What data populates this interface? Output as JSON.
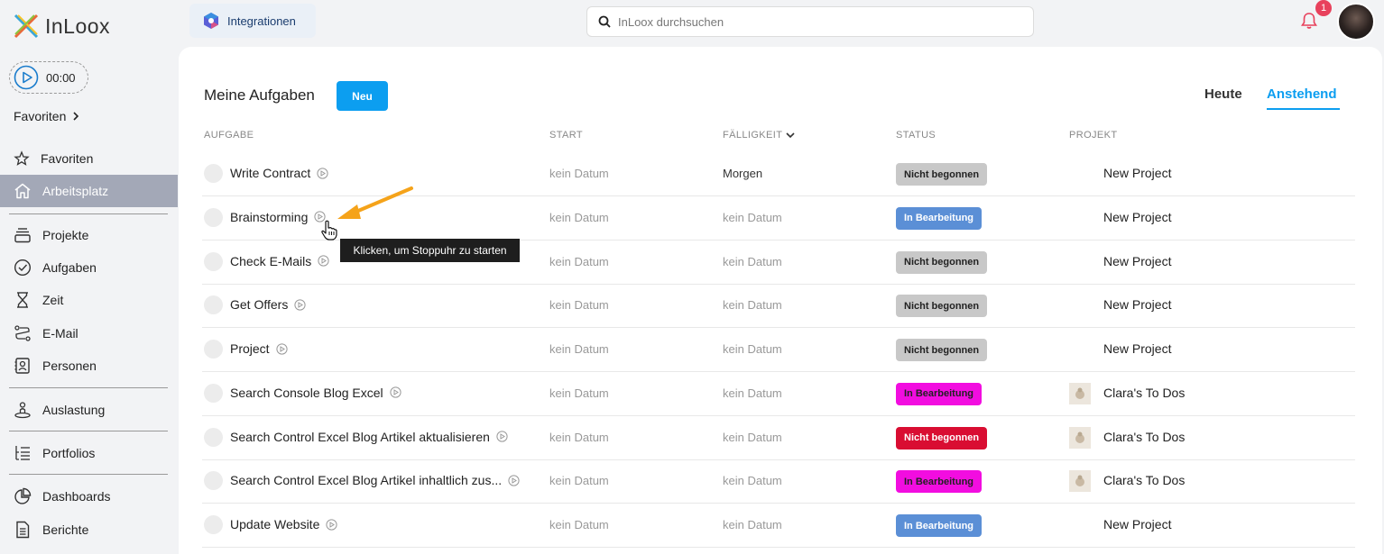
{
  "app": {
    "logo_text": "InLoox"
  },
  "header": {
    "integrations_label": "Integrationen",
    "search_placeholder": "InLoox durchsuchen",
    "notifications_count": "1"
  },
  "sidebar": {
    "timer": "00:00",
    "favorites_header": "Favoriten",
    "items": [
      {
        "label": "Favoriten",
        "icon": "star-icon"
      },
      {
        "label": "Arbeitsplatz",
        "icon": "home-icon",
        "active": true
      },
      {
        "label": "Projekte",
        "icon": "projects-icon"
      },
      {
        "label": "Aufgaben",
        "icon": "check-circle-icon"
      },
      {
        "label": "Zeit",
        "icon": "hourglass-icon"
      },
      {
        "label": "E-Mail",
        "icon": "email-route-icon"
      },
      {
        "label": "Personen",
        "icon": "contacts-icon"
      },
      {
        "label": "Auslastung",
        "icon": "workload-icon"
      },
      {
        "label": "Portfolios",
        "icon": "portfolio-list-icon"
      },
      {
        "label": "Dashboards",
        "icon": "pie-chart-icon"
      },
      {
        "label": "Berichte",
        "icon": "report-icon"
      }
    ]
  },
  "main": {
    "title": "Meine Aufgaben",
    "new_button": "Neu",
    "tabs": [
      {
        "label": "Heute"
      },
      {
        "label": "Anstehend",
        "active": true
      }
    ],
    "columns": {
      "task": "AUFGABE",
      "start": "START",
      "due": "FÄLLIGKEIT",
      "status": "STATUS",
      "project": "PROJEKT"
    },
    "rows": [
      {
        "name": "Write Contract",
        "start": "kein Datum",
        "due": "Morgen",
        "status": "Nicht begonnen",
        "status_color": "#c8c8c8",
        "status_text_color": "#222222",
        "project": "New Project"
      },
      {
        "name": "Brainstorming",
        "start": "kein Datum",
        "due": "kein Datum",
        "status": "In Bearbeitung",
        "status_color": "#5b8fd6",
        "status_text_color": "#ffffff",
        "project": "New Project"
      },
      {
        "name": "Check E-Mails",
        "start": "kein Datum",
        "due": "kein Datum",
        "status": "Nicht begonnen",
        "status_color": "#c8c8c8",
        "status_text_color": "#222222",
        "project": "New Project"
      },
      {
        "name": "Get Offers",
        "start": "kein Datum",
        "due": "kein Datum",
        "status": "Nicht begonnen",
        "status_color": "#c8c8c8",
        "status_text_color": "#222222",
        "project": "New Project"
      },
      {
        "name": "Project",
        "start": "kein Datum",
        "due": "kein Datum",
        "status": "Nicht begonnen",
        "status_color": "#c8c8c8",
        "status_text_color": "#222222",
        "project": "New Project"
      },
      {
        "name": "Search Console Blog Excel",
        "start": "kein Datum",
        "due": "kein Datum",
        "status": "In Bearbeitung",
        "status_color": "#f20de0",
        "status_text_color": "#222222",
        "project": "Clara's To Dos"
      },
      {
        "name": "Search Control Excel Blog Artikel aktualisieren",
        "start": "kein Datum",
        "due": "kein Datum",
        "status": "Nicht begonnen",
        "status_color": "#d90d32",
        "status_text_color": "#ffffff",
        "project": "Clara's To Dos"
      },
      {
        "name": "Search Control Excel Blog Artikel inhaltlich zus...",
        "start": "kein Datum",
        "due": "kein Datum",
        "status": "In Bearbeitung",
        "status_color": "#f20de0",
        "status_text_color": "#222222",
        "project": "Clara's To Dos"
      },
      {
        "name": "Update Website",
        "start": "kein Datum",
        "due": "kein Datum",
        "status": "In Bearbeitung",
        "status_color": "#5b8fd6",
        "status_text_color": "#ffffff",
        "project": "New Project"
      }
    ]
  },
  "tooltip": "Klicken, um Stoppuhr zu starten",
  "colors": {
    "accent": "#0c9ef0",
    "arrow": "#f5a31a",
    "sidebar_active": "#a3a8b7"
  }
}
